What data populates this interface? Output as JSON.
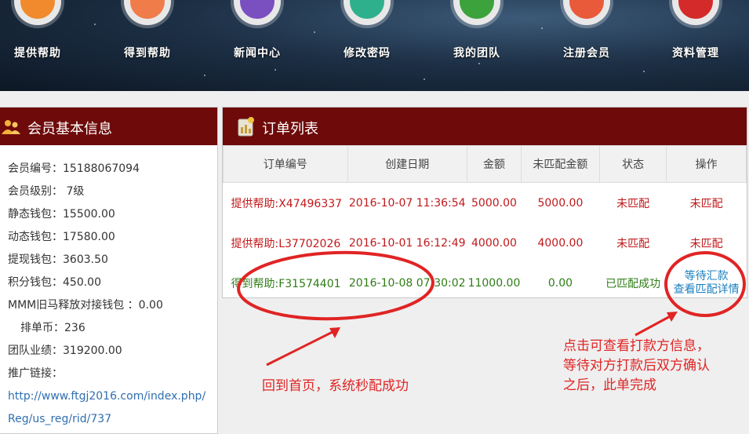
{
  "nav": {
    "items": [
      {
        "label": "提供帮助",
        "icon": "help-offer-icon",
        "color": "#f08a2c"
      },
      {
        "label": "得到帮助",
        "icon": "help-receive-icon",
        "color": "#f07c4a"
      },
      {
        "label": "新闻中心",
        "icon": "globe-icon",
        "color": "#7a4fc0"
      },
      {
        "label": "修改密码",
        "icon": "edit-icon",
        "color": "#2fb08c"
      },
      {
        "label": "我的团队",
        "icon": "team-icon",
        "color": "#3ca23c"
      },
      {
        "label": "注册会员",
        "icon": "register-icon",
        "color": "#e85a3a"
      },
      {
        "label": "资料管理",
        "icon": "tools-icon",
        "color": "#d42a2a"
      }
    ]
  },
  "member": {
    "title": "会员基本信息",
    "rows": [
      "会员编号：15188067094",
      "会员级别： 7级",
      "静态钱包：15500.00",
      "动态钱包：17580.00",
      "提现钱包：3603.50",
      "积分钱包：450.00",
      "MMM旧马释放对接钱包 ：0.00",
      "排单币：236",
      "团队业绩：319200.00",
      "推广链接：",
      "http://www.ftgj2016.com/index.php/",
      "Reg/us_reg/rid/737"
    ]
  },
  "orders": {
    "title": "订单列表",
    "headers": [
      "订单编号",
      "创建日期",
      "金额",
      "未匹配金额",
      "状态",
      "操作"
    ],
    "rows": [
      {
        "id": "提供帮助:X47496337",
        "date": "2016-10-07 11:36:54",
        "amount": "5000.00",
        "unmatched": "5000.00",
        "status": "未匹配",
        "op1": "未匹配",
        "op2": ""
      },
      {
        "id": "提供帮助:L37702026",
        "date": "2016-10-01 16:12:49",
        "amount": "4000.00",
        "unmatched": "4000.00",
        "status": "未匹配",
        "op1": "未匹配",
        "op2": ""
      },
      {
        "id": "得到帮助:F31574401",
        "date": "2016-10-08 07:30:02",
        "amount": "11000.00",
        "unmatched": "0.00",
        "status": "已匹配成功",
        "op1": "等待汇款",
        "op2": "查看匹配详情"
      }
    ]
  },
  "annotations": {
    "left": "回到首页，系统秒配成功",
    "right": [
      "点击可查看打款方信息，",
      "等待对方打款后双方确认",
      "之后，此单完成"
    ]
  },
  "colors": {
    "header": "#6e0a0a",
    "annotation": "#e02424",
    "pending": "#c0191b",
    "matched": "#2e7d16",
    "link": "#1a7fbe"
  }
}
